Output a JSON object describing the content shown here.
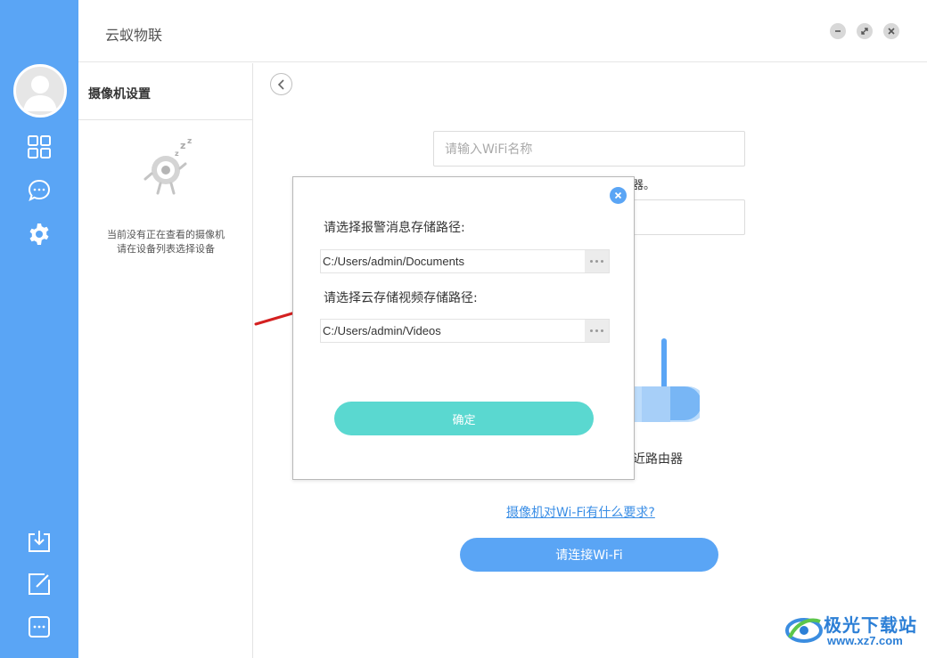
{
  "app": {
    "title": "云蚁物联"
  },
  "colors": {
    "accent": "#5aa5f5",
    "confirm": "#5ad8d0",
    "link": "#3a8ee6"
  },
  "sidebar": {
    "top_icons": [
      "avatar",
      "grid-icon",
      "message-icon",
      "gear-icon"
    ],
    "bottom_icons": [
      "download-icon",
      "edit-icon",
      "more-icon"
    ]
  },
  "left_panel": {
    "title": "摄像机设置",
    "empty_line1": "当前没有正在查看的摄像机",
    "empty_line2": "请在设备列表选择设备"
  },
  "main": {
    "wifi_name_placeholder": "请输入WiFi名称",
    "partial_hint": "器。",
    "router_text_partial": "近路由器",
    "wifi_help_link": "摄像机对Wi-Fi有什么要求?",
    "connect_button": "请连接Wi-Fi"
  },
  "dialog": {
    "alarm_label": "请选择报警消息存储路径:",
    "alarm_path": "C:/Users/admin/Documents",
    "video_label": "请选择云存储视频存储路径:",
    "video_path": "C:/Users/admin/Videos",
    "confirm_button": "确定"
  },
  "watermark": {
    "name": "极光下载站",
    "url": "www.xz7.com"
  }
}
